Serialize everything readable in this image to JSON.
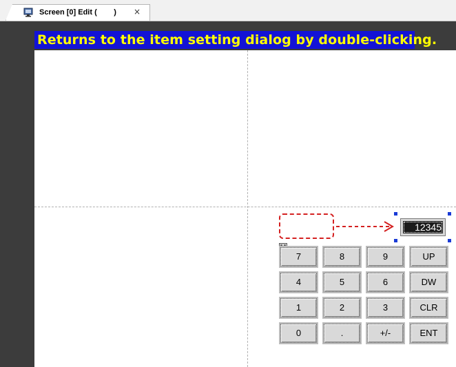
{
  "tab": {
    "title": "Screen [0] Edit (        )",
    "close_glyph": "×",
    "icon": "monitor-icon"
  },
  "banner": {
    "text": "Returns to the item setting dialog by double-clicking."
  },
  "numeric_display": {
    "value": "12345"
  },
  "keypad": {
    "icon": "keypad-icon",
    "rows": [
      [
        "7",
        "8",
        "9",
        "UP"
      ],
      [
        "4",
        "5",
        "6",
        "DW"
      ],
      [
        "1",
        "2",
        "3",
        "CLR"
      ],
      [
        "0",
        ".",
        "+/-",
        "ENT"
      ]
    ]
  },
  "colors": {
    "banner_bg": "#1313d6",
    "banner_text": "#ffff00",
    "highlight_dashed": "#d42020",
    "selection_handle": "#1a3bd6",
    "panel": "#3c3c3c"
  }
}
